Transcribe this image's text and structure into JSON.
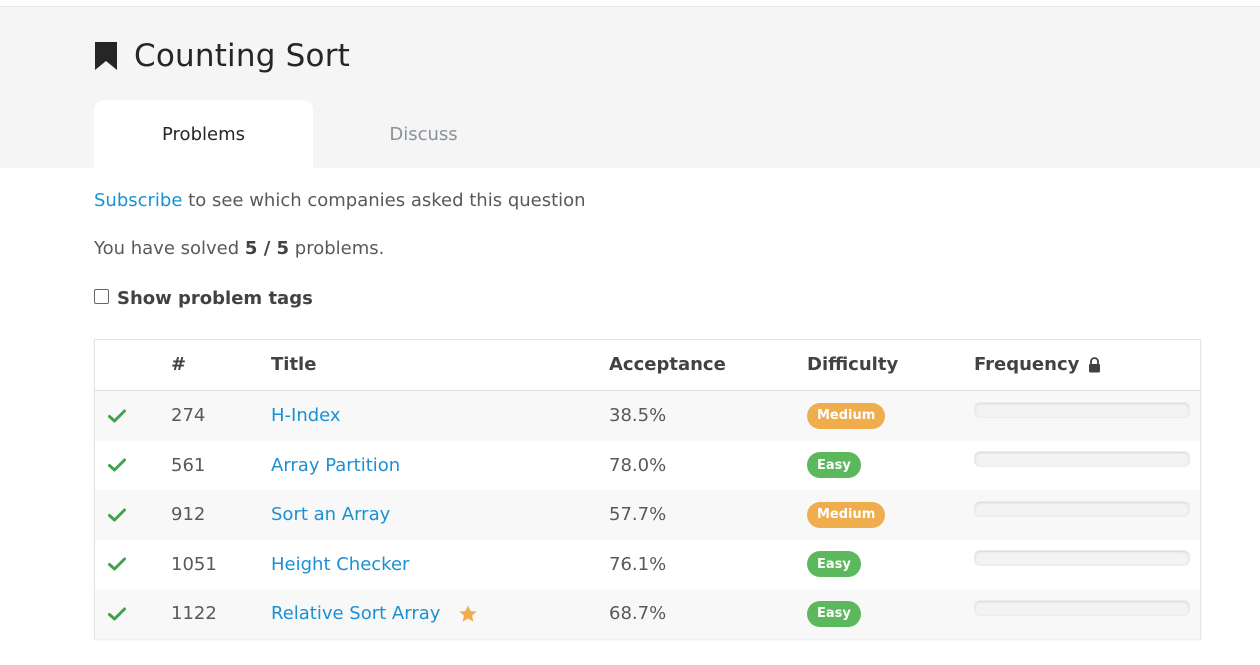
{
  "page": {
    "title": "Counting Sort"
  },
  "tabs": [
    {
      "label": "Problems",
      "active": true
    },
    {
      "label": "Discuss",
      "active": false
    }
  ],
  "subscribe": {
    "link_text": "Subscribe",
    "rest_text": " to see which companies asked this question"
  },
  "solved": {
    "prefix": "You have solved ",
    "count": "5 / 5",
    "suffix": " problems."
  },
  "tags": {
    "label": "Show problem tags",
    "checked": false
  },
  "table": {
    "headers": {
      "number": "#",
      "title": "Title",
      "acceptance": "Acceptance",
      "difficulty": "Difficulty",
      "frequency": "Frequency"
    },
    "rows": [
      {
        "number": "274",
        "title": "H-Index",
        "acceptance": "38.5%",
        "difficulty": "Medium",
        "solved": true,
        "starred": false
      },
      {
        "number": "561",
        "title": "Array Partition",
        "acceptance": "78.0%",
        "difficulty": "Easy",
        "solved": true,
        "starred": false
      },
      {
        "number": "912",
        "title": "Sort an Array",
        "acceptance": "57.7%",
        "difficulty": "Medium",
        "solved": true,
        "starred": false
      },
      {
        "number": "1051",
        "title": "Height Checker",
        "acceptance": "76.1%",
        "difficulty": "Easy",
        "solved": true,
        "starred": false
      },
      {
        "number": "1122",
        "title": "Relative Sort Array",
        "acceptance": "68.7%",
        "difficulty": "Easy",
        "solved": true,
        "starred": true
      }
    ]
  },
  "colors": {
    "link": "#1a90d5",
    "medium": "#f0ad4e",
    "easy": "#5cb85c",
    "check": "#3fa34d",
    "star": "#f0ad4e"
  },
  "icons": {
    "title": "bookmark-icon",
    "frequency": "lock-icon",
    "solved": "check-icon",
    "starred": "star-icon"
  }
}
